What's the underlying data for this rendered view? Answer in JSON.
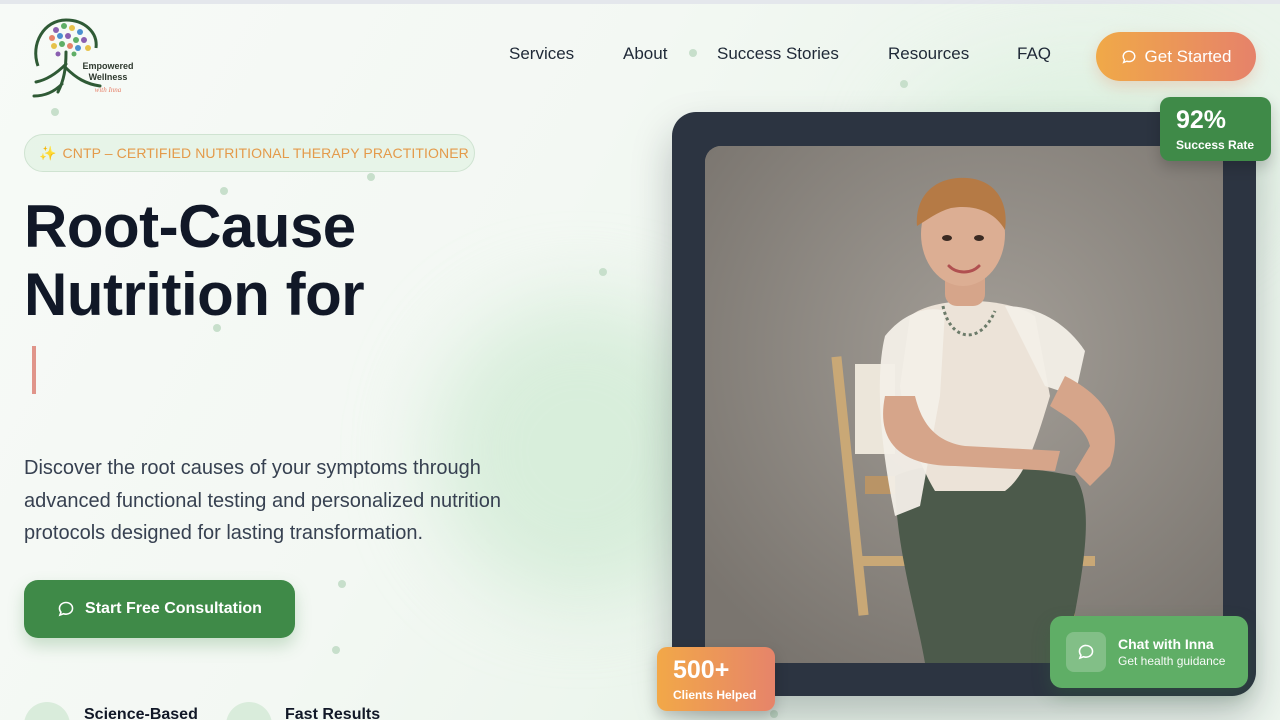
{
  "brand": {
    "name_line1": "Empowered",
    "name_line2": "Wellness",
    "name_line3": "with Inna"
  },
  "nav": {
    "items": [
      {
        "label": "Services"
      },
      {
        "label": "About"
      },
      {
        "label": "Success Stories"
      },
      {
        "label": "Resources"
      },
      {
        "label": "FAQ"
      }
    ],
    "cta_label": "Get Started"
  },
  "hero": {
    "badge": "CNTP – CERTIFIED NUTRITIONAL THERAPY PRACTITIONER",
    "badge_icon": "sparkle-icon",
    "title_line1": "Root-Cause",
    "title_line2": "Nutrition for",
    "description": "Discover the root causes of your symptoms through advanced functional testing and personalized nutrition protocols designed for lasting transformation.",
    "cta_label": "Start Free Consultation",
    "features": [
      {
        "label": "Science-Based"
      },
      {
        "label": "Fast Results"
      }
    ]
  },
  "stats": {
    "success_value": "92%",
    "success_label": "Success Rate",
    "clients_value": "500+",
    "clients_label": "Clients Helped"
  },
  "chat": {
    "title": "Chat with Inna",
    "subtitle": "Get health guidance"
  },
  "colors": {
    "primary_green": "#3f8a48",
    "accent_orange": "#f0a948",
    "accent_coral": "#e6826a",
    "frame_dark": "#2c3441"
  }
}
